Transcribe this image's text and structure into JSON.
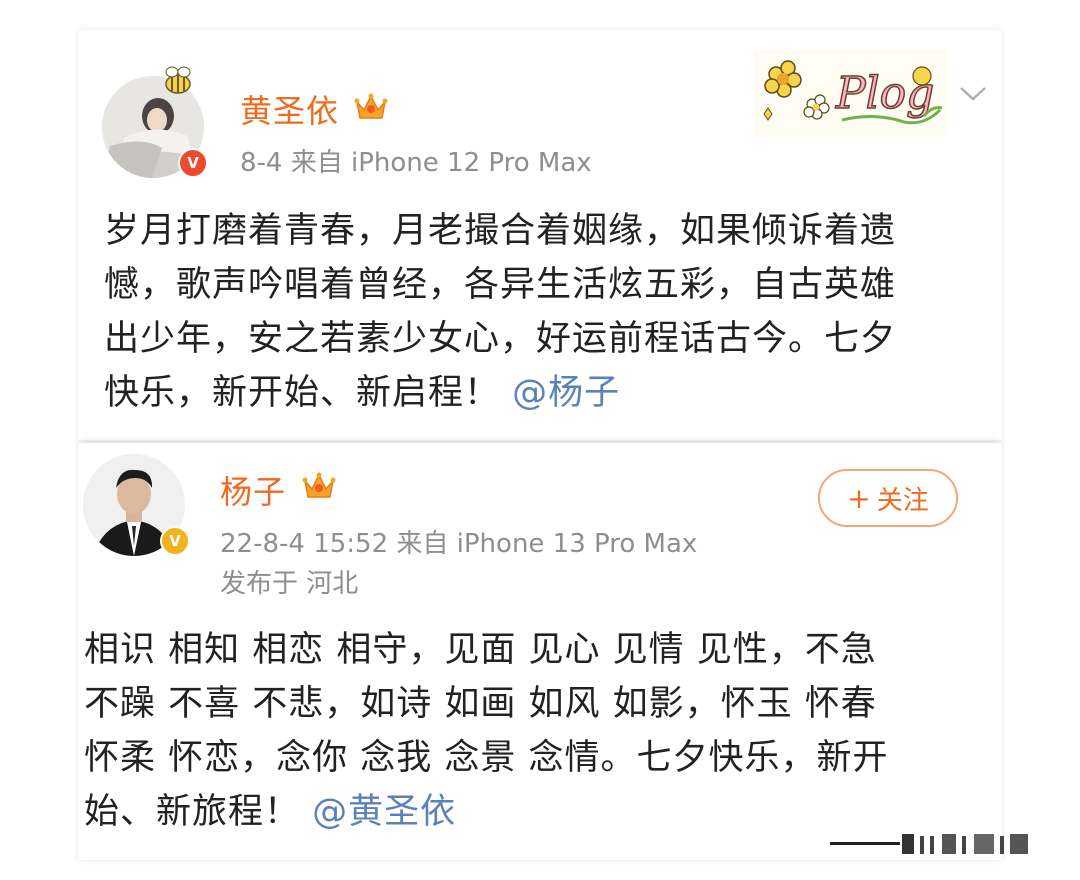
{
  "post1": {
    "author": "黄圣依",
    "verified_badge": "V",
    "meta": "8-4  来自 iPhone 12 Pro Max",
    "decoration": "Plog",
    "text_lines": [
      "岁月打磨着青春，月老撮合着姻缘，如果倾诉着遗",
      "憾，歌声吟唱着曾经，各异生活炫五彩，自古英雄",
      "出少年，安之若素少女心，好运前程话古今。七夕",
      "快乐，新开始、新启程！"
    ],
    "mention": "@杨子",
    "icons": {
      "crown": "crown-icon",
      "more": "chevron-down-icon"
    },
    "colors": {
      "name": "#f06a1e",
      "badge": "#ee4a2d",
      "mention": "#5b82b8"
    }
  },
  "post2": {
    "author": "杨子",
    "verified_badge": "V",
    "meta": "22-8-4 15:52  来自 iPhone 13 Pro Max",
    "location": "发布于 河北",
    "follow_label": "关注",
    "follow_plus": "+",
    "text_lines": [
      "相识 相知 相恋 相守，见面 见心 见情 见性，不急",
      "不躁 不喜 不悲，如诗 如画 如风 如影，怀玉 怀春",
      "怀柔 怀恋，念你 念我 念景 念情。七夕快乐，新开",
      "始、新旅程！"
    ],
    "mention": "@黄圣依",
    "icons": {
      "crown": "crown-icon"
    },
    "colors": {
      "name": "#f06a1e",
      "badge": "#f3b31e",
      "follow_border": "#f2a774"
    }
  }
}
